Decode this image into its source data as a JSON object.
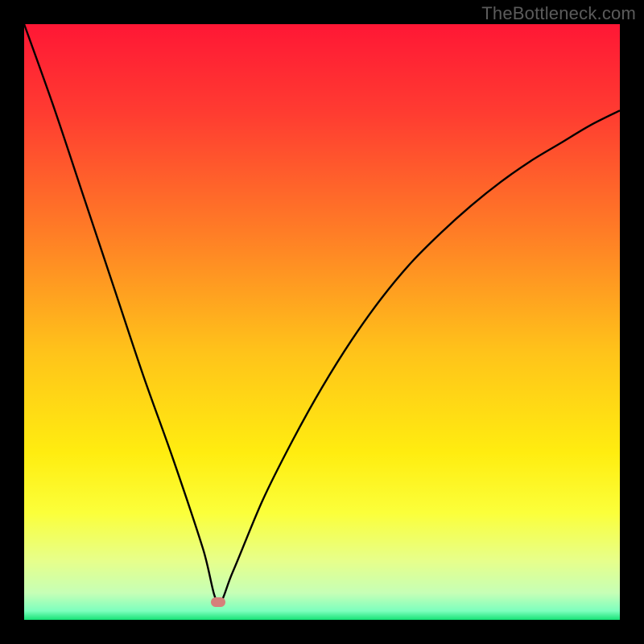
{
  "watermark": "TheBottleneck.com",
  "colors": {
    "frame": "#000000",
    "watermark": "#5b5b5b",
    "curve": "#000000",
    "marker": "#d67f7a",
    "gradient_stops": [
      {
        "offset": 0.0,
        "color": "#ff1735"
      },
      {
        "offset": 0.15,
        "color": "#ff3c31"
      },
      {
        "offset": 0.35,
        "color": "#ff7d26"
      },
      {
        "offset": 0.55,
        "color": "#ffc31a"
      },
      {
        "offset": 0.72,
        "color": "#ffed10"
      },
      {
        "offset": 0.82,
        "color": "#fbff3a"
      },
      {
        "offset": 0.9,
        "color": "#e7ff8a"
      },
      {
        "offset": 0.955,
        "color": "#c6ffb6"
      },
      {
        "offset": 0.985,
        "color": "#7dffbe"
      },
      {
        "offset": 1.0,
        "color": "#16e276"
      }
    ]
  },
  "chart_data": {
    "type": "line",
    "title": "",
    "xlabel": "",
    "ylabel": "",
    "xlim": [
      0,
      100
    ],
    "ylim": [
      0,
      100
    ],
    "grid": false,
    "marker": {
      "x": 32.5,
      "y": 3,
      "color": "#d67f7a"
    },
    "series": [
      {
        "name": "bottleneck-curve",
        "x": [
          0,
          5,
          10,
          15,
          20,
          25,
          30,
          32.5,
          35,
          40,
          45,
          50,
          55,
          60,
          65,
          70,
          75,
          80,
          85,
          90,
          95,
          100
        ],
        "y": [
          100,
          86,
          71,
          56,
          41,
          27,
          12,
          3,
          8,
          20,
          30,
          39,
          47,
          54,
          60,
          65,
          69.5,
          73.5,
          77,
          80,
          83,
          85.5
        ]
      }
    ]
  }
}
